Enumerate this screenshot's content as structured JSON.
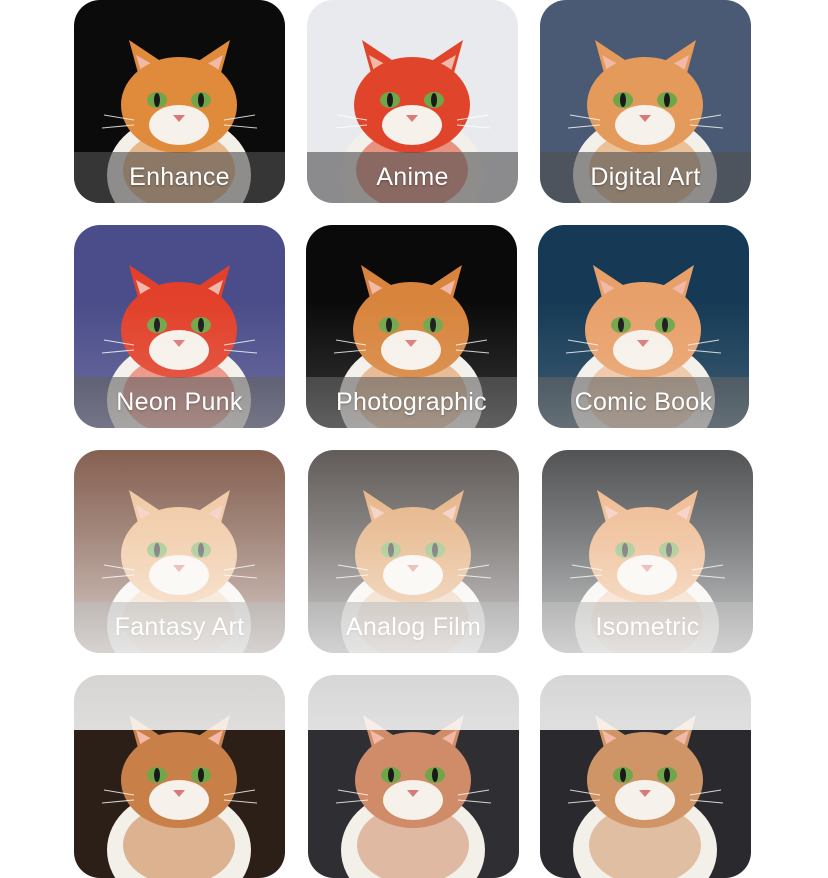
{
  "styles": [
    {
      "label": "Enhance",
      "icon": "cat-enhance-thumbnail",
      "bg": "#0b0b0b",
      "fur": "#e08a3c"
    },
    {
      "label": "Anime",
      "icon": "cat-anime-thumbnail",
      "bg": "#e9eaee",
      "fur": "#e0452b"
    },
    {
      "label": "Digital Art",
      "icon": "cat-digital-art-thumbnail",
      "bg": "#4a5a74",
      "fur": "#e49a5a"
    },
    {
      "label": "Neon Punk",
      "icon": "cat-neon-punk-thumbnail",
      "bg": "#4b4d8a",
      "fur": "#e2402a"
    },
    {
      "label": "Photographic",
      "icon": "cat-photographic-thumbnail",
      "bg": "#0a0a0a",
      "fur": "#d8843c"
    },
    {
      "label": "Comic Book",
      "icon": "cat-comic-book-thumbnail",
      "bg": "#163a55",
      "fur": "#e8a06a"
    },
    {
      "label": "Fantasy Art",
      "icon": "cat-fantasy-art-thumbnail",
      "bg": "#5a2814",
      "fur": "#e8ad74"
    },
    {
      "label": "Analog Film",
      "icon": "cat-analog-film-thumbnail",
      "bg": "#2a2320",
      "fur": "#d9904c"
    },
    {
      "label": "Isometric",
      "icon": "cat-isometric-thumbnail",
      "bg": "#151719",
      "fur": "#e69a5c"
    },
    {
      "label": "",
      "icon": "cat-thumbnail",
      "bg": "#2c1f18",
      "fur": "#c98048"
    },
    {
      "label": "",
      "icon": "cat-thumbnail",
      "bg": "#2e2e33",
      "fur": "#d08c68"
    },
    {
      "label": "",
      "icon": "cat-thumbnail",
      "bg": "#2a2a2e",
      "fur": "#cf9566"
    }
  ]
}
